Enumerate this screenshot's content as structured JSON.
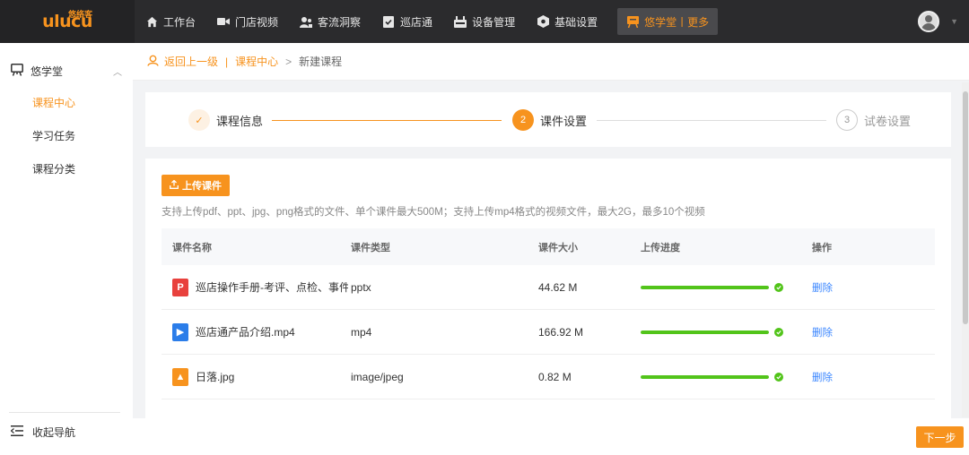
{
  "brand": {
    "logo_text": "ulucu",
    "logo_cn": "悠络客"
  },
  "nav": {
    "items": [
      {
        "label": "工作台",
        "icon": "home-icon"
      },
      {
        "label": "门店视频",
        "icon": "video-icon"
      },
      {
        "label": "客流洞察",
        "icon": "people-icon"
      },
      {
        "label": "巡店通",
        "icon": "clipboard-check-icon"
      },
      {
        "label": "设备管理",
        "icon": "device-icon"
      },
      {
        "label": "基础设置",
        "icon": "settings-icon"
      }
    ],
    "active": {
      "label": "悠学堂丨更多",
      "icon": "classroom-icon"
    }
  },
  "sidebar": {
    "section": {
      "label": "悠学堂",
      "icon": "classroom-icon"
    },
    "items": [
      {
        "label": "课程中心",
        "active": true
      },
      {
        "label": "学习任务",
        "active": false
      },
      {
        "label": "课程分类",
        "active": false
      }
    ],
    "collapse_label": "收起导航"
  },
  "breadcrumb": {
    "back": "返回上一级",
    "sep": "|",
    "parent": "课程中心",
    "current": "新建课程"
  },
  "steps": [
    {
      "number": "✓",
      "label": "课程信息",
      "state": "done"
    },
    {
      "number": "2",
      "label": "课件设置",
      "state": "current"
    },
    {
      "number": "3",
      "label": "试卷设置",
      "state": "pending"
    }
  ],
  "upload": {
    "button_label": "上传课件",
    "hint": "支持上传pdf、ppt、jpg、png格式的文件、单个课件最大500M；支持上传mp4格式的视频文件，最大2G，最多10个视频"
  },
  "table": {
    "headers": [
      "课件名称",
      "课件类型",
      "课件大小",
      "上传进度",
      "操作"
    ],
    "rows": [
      {
        "name": "巡店操作手册-考评、点检、事件.pptx",
        "type": "pptx",
        "size": "44.62 M",
        "progress": 1.0,
        "action": "删除",
        "icon": "ppt-file-icon",
        "icon_color": "#e8413d",
        "icon_glyph": "P"
      },
      {
        "name": "巡店通产品介绍.mp4",
        "type": "mp4",
        "size": "166.92 M",
        "progress": 1.0,
        "action": "删除",
        "icon": "video-file-icon",
        "icon_color": "#2b7de9",
        "icon_glyph": "▶"
      },
      {
        "name": "日落.jpg",
        "type": "image/jpeg",
        "size": "0.82 M",
        "progress": 1.0,
        "action": "删除",
        "icon": "image-file-icon",
        "icon_color": "#f7931e",
        "icon_glyph": "▲"
      }
    ]
  },
  "footer": {
    "next_label": "下一步"
  },
  "colors": {
    "accent": "#f7931e",
    "success": "#52c41a",
    "link": "#3a86ff"
  }
}
